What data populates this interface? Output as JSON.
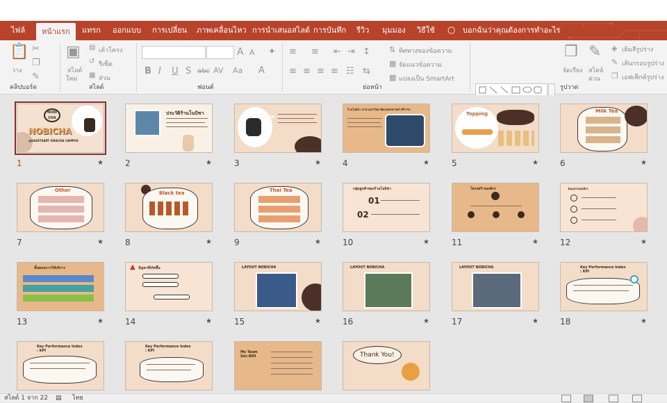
{
  "tabs": [
    "ไฟล์",
    "หน้าแรก",
    "แทรก",
    "ออกแบบ",
    "การเปลี่ยน",
    "ภาพเคลื่อนไหว",
    "การนำเสนอสไลด์",
    "การบันทึก",
    "รีวิว",
    "มุมมอง",
    "วิธีใช้"
  ],
  "tell_me": "บอกฉันว่าคุณต้องการทำอะไร",
  "ribbon": {
    "clipboard": {
      "paste": "วาง",
      "group": "คลิปบอร์ด"
    },
    "slides": {
      "new_slide": "สไลด์",
      "new_slide2": "ใหม่",
      "layout": "เค้าโครง",
      "reset": "รีเซ็ต",
      "section": "ส่วน",
      "group": "สไลด์"
    },
    "font": {
      "group": "ฟอนต์",
      "bold": "B",
      "italic": "I",
      "underline": "U",
      "shadow": "S",
      "strike": "abc",
      "spacing": "AV",
      "case": "Aa",
      "color": "A",
      "grow": "A",
      "shrink": "A"
    },
    "paragraph": {
      "direction": "ทิศทางของข้อความ",
      "align": "จัดแนวข้อความ",
      "smartart": "แปลงเป็น SmartArt",
      "group": "ย่อหน้า"
    },
    "drawing": {
      "arrange": "จัดเรียง",
      "arrange_sub": "ลำดับ",
      "quick_styles": "สไตล์",
      "quick_styles2": "ด่วน",
      "fill": "เติมสีรูปร่าง",
      "outline": "เส้นกรอบรูปร่าง",
      "effects": "เอฟเฟ็กต์รูปร่าง",
      "group": "รูปวาด"
    }
  },
  "slides": [
    {
      "num": "1",
      "title": "NOBICHA",
      "subtitle": "@KASETSART SIRACHA CAMPUS",
      "logo": "NOBI CHA"
    },
    {
      "num": "2",
      "title": "ประวัติร้านโนบิชา"
    },
    {
      "num": "3",
      "title": "Rabbit Time"
    },
    {
      "num": "4",
      "title": "ร้านโนบิชา สาขามหาวิทยาลัยเกษตรศาสตร์ ศรีราชา"
    },
    {
      "num": "5",
      "title": "Topping"
    },
    {
      "num": "6",
      "title": "Milk Tea"
    },
    {
      "num": "7",
      "title": "Other"
    },
    {
      "num": "8",
      "title": "Black tea"
    },
    {
      "num": "9",
      "title": "Thai Tea"
    },
    {
      "num": "10",
      "title": "กลุ่มลูกค้าของร้านโนบิชา",
      "p1": "01",
      "p2": "02"
    },
    {
      "num": "11",
      "title": "โครงสร้างองค์กร"
    },
    {
      "num": "12",
      "title": "วัฒนธรรมองค์กร"
    },
    {
      "num": "13",
      "title": "ขั้นตอนการให้บริการ"
    },
    {
      "num": "14",
      "title": "ปัญหาที่เกิดขึ้น"
    },
    {
      "num": "15",
      "title": "LAYOUT NOBICHA"
    },
    {
      "num": "16",
      "title": "LAYOUT NOBICHA"
    },
    {
      "num": "17",
      "title": "LAYOUT NOBICHA"
    },
    {
      "num": "18",
      "title": "Key Performance Index",
      "subtitle": ": KPI"
    },
    {
      "num": "19",
      "title": "Key Performance Index",
      "subtitle": ": KPI"
    },
    {
      "num": "20",
      "title": "Key Performance Index",
      "subtitle": ": KPI"
    },
    {
      "num": "21",
      "title": "My Team",
      "subtitle": "Sec:800"
    },
    {
      "num": "22",
      "title": "Thank You!"
    }
  ],
  "status": {
    "slide_info": "สไลด์ 1 จาก 22",
    "language": "ไทย"
  },
  "colors": {
    "accent": "#b8432b",
    "slide_bg": "#f3dcc8",
    "dark_blob": "#4a3026",
    "tan": "#e7b98a"
  }
}
